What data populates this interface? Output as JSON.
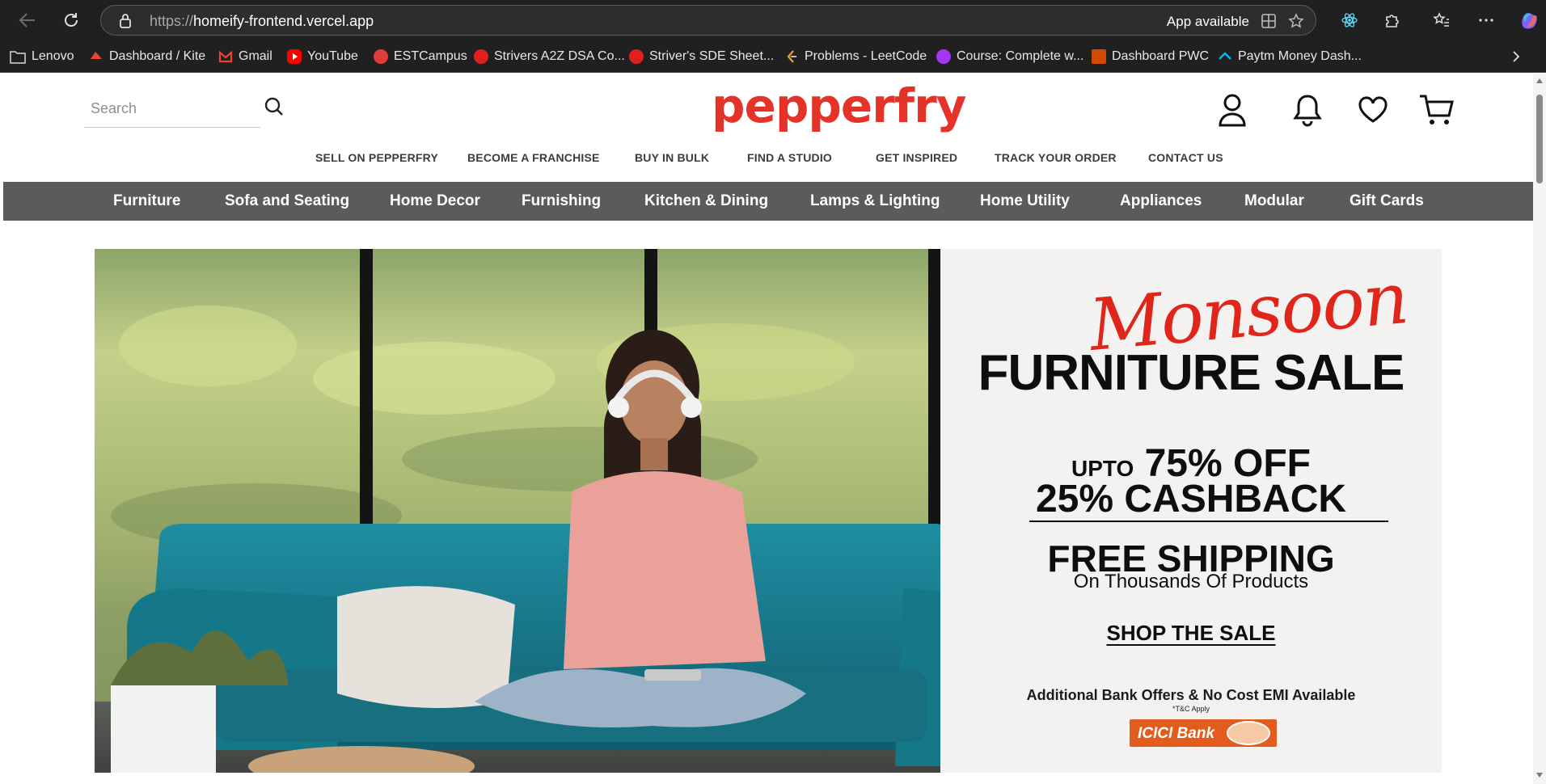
{
  "browser": {
    "url_protocol": "https://",
    "url_host": "homeify-frontend.vercel.app",
    "app_available": "App available",
    "bookmarks": [
      {
        "label": "Lenovo",
        "icon": "folder-icon",
        "color": "#d8d8d8"
      },
      {
        "label": "Dashboard / Kite",
        "icon": "kite-icon",
        "color": "#e8472b"
      },
      {
        "label": "Gmail",
        "icon": "gmail-icon",
        "color": "#ea4335"
      },
      {
        "label": "YouTube",
        "icon": "youtube-icon",
        "color": "#ff0000"
      },
      {
        "label": "ESTCampus",
        "icon": "estcampus-icon",
        "color": "#e23b3b"
      },
      {
        "label": "Strivers A2Z DSA Co...",
        "icon": "tuf-icon",
        "color": "#e02020"
      },
      {
        "label": "Striver's SDE Sheet...",
        "icon": "tuf-icon",
        "color": "#e02020"
      },
      {
        "label": "Problems - LeetCode",
        "icon": "leetcode-icon",
        "color": "#f0a030"
      },
      {
        "label": "Course: Complete w...",
        "icon": "udemy-icon",
        "color": "#a435f0"
      },
      {
        "label": "Dashboard PWC",
        "icon": "pwc-icon",
        "color": "#d04a02"
      },
      {
        "label": "Paytm Money Dash...",
        "icon": "paytm-icon",
        "color": "#00b9f1"
      }
    ]
  },
  "header": {
    "search_placeholder": "Search",
    "logo": "pepperfry",
    "brand_color": "#e5332a",
    "top_links": [
      "SELL ON PEPPERFRY",
      "BECOME A FRANCHISE",
      "BUY IN BULK",
      "FIND A STUDIO",
      "GET INSPIRED",
      "TRACK YOUR ORDER",
      "CONTACT US"
    ]
  },
  "categories": [
    "Furniture",
    "Sofa and Seating",
    "Home Decor",
    "Furnishing",
    "Kitchen & Dining",
    "Lamps & Lighting",
    "Home Utility",
    "Appliances",
    "Modular",
    "Gift Cards"
  ],
  "banner": {
    "script_title": "Monsoon",
    "title": "FURNITURE SALE",
    "upto_prefix": "UPTO",
    "discount": "75% OFF",
    "cashback": "25% CASHBACK",
    "free_shipping": "FREE SHIPPING",
    "free_shipping_sub": "On Thousands Of Products",
    "cta": "SHOP THE SALE",
    "bank_offer": "Additional Bank Offers & No Cost EMI Available",
    "tnc": "*T&C Apply",
    "bank_logo": "ICICI Bank",
    "accent_color": "#e0251b"
  }
}
